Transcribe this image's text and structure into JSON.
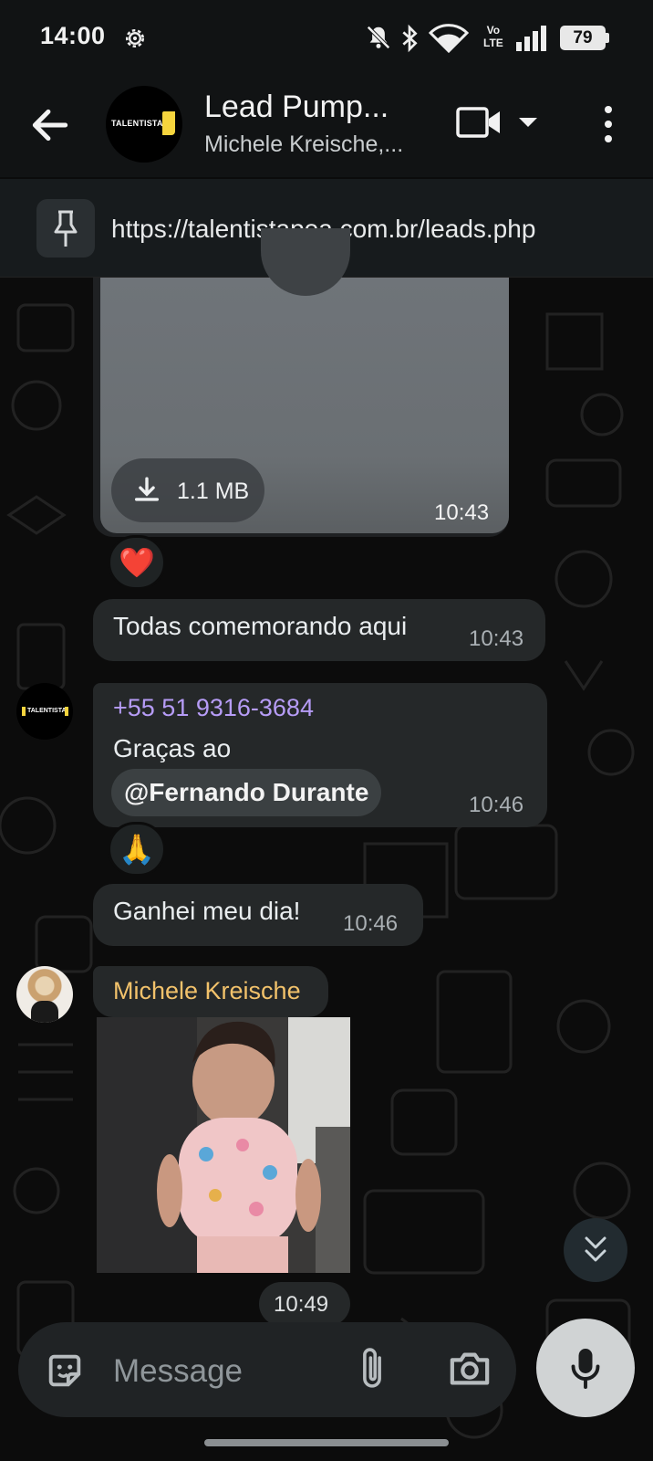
{
  "status_bar": {
    "time": "14:00",
    "volte_top": "Vo",
    "volte_bottom": "LTE",
    "battery": "79",
    "icons": [
      "gear-icon",
      "mute-notifications-icon",
      "bluetooth-icon",
      "wifi-icon",
      "volte-icon",
      "signal-icon",
      "battery-icon"
    ]
  },
  "header": {
    "avatar_text": "TALENTISTA",
    "title": "Lead Pump...",
    "subtitle": "Michele Kreische,..."
  },
  "pinned": {
    "text": "https://talentistapoa.com.br/leads.php"
  },
  "messages": {
    "media": {
      "size": "1.1 MB",
      "time": "10:43",
      "reaction": "❤️"
    },
    "m1": {
      "text": "Todas comemorando aqui",
      "time": "10:43"
    },
    "m2": {
      "sender": "+55 51 9316-3684",
      "avatar_text": "TALENTISTA",
      "line": "Graças ao",
      "mention": "@Fernando Durante",
      "time": "10:46",
      "reaction": "🙏"
    },
    "m3": {
      "text": "Ganhei meu dia!",
      "time": "10:46"
    },
    "m4": {
      "sender": "Michele Kreische",
      "time": "10:49"
    }
  },
  "composer": {
    "placeholder": "Message"
  },
  "colors": {
    "bubble": "#252829",
    "sender_purple": "#b69cf6",
    "sender_gold": "#f2c26b",
    "background": "#0c0c0c"
  }
}
